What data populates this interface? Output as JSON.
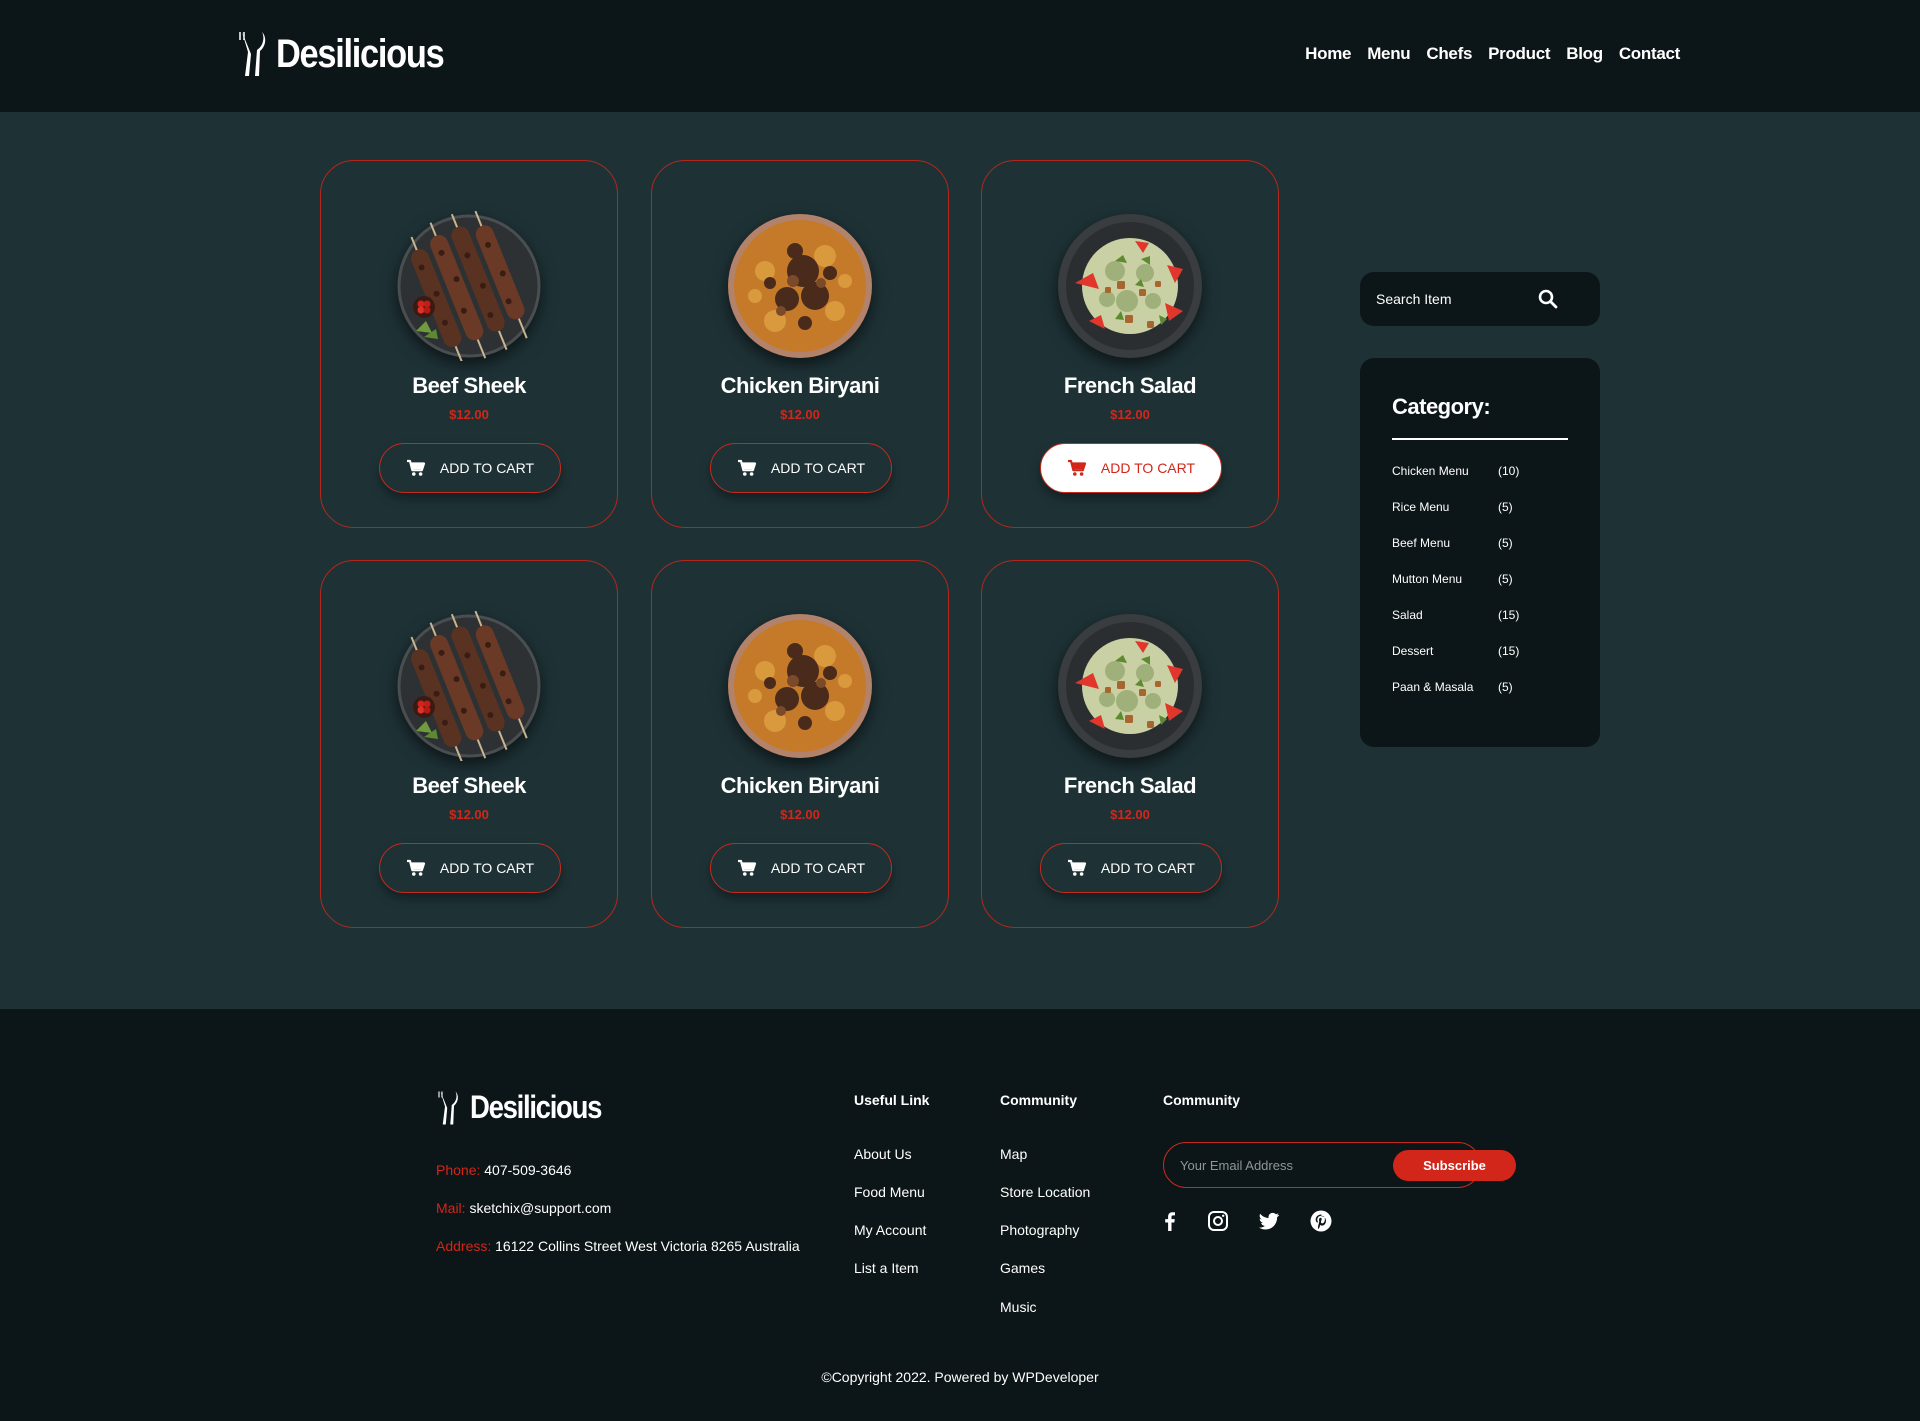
{
  "brand": {
    "name": "Desilicious"
  },
  "nav": [
    {
      "label": "Home"
    },
    {
      "label": "Menu"
    },
    {
      "label": "Chefs"
    },
    {
      "label": "Product"
    },
    {
      "label": "Blog"
    },
    {
      "label": "Contact"
    }
  ],
  "products": [
    {
      "name": "Beef Sheek",
      "price": "$12.00",
      "button": "ADD TO CART",
      "image": "beef-kebab"
    },
    {
      "name": "Chicken Biryani",
      "price": "$12.00",
      "button": "ADD TO CART",
      "image": "biryani"
    },
    {
      "name": "French Salad",
      "price": "$12.00",
      "button": "ADD TO CART",
      "image": "salad",
      "highlighted": true
    },
    {
      "name": "Beef Sheek",
      "price": "$12.00",
      "button": "ADD TO CART",
      "image": "beef-kebab"
    },
    {
      "name": "Chicken Biryani",
      "price": "$12.00",
      "button": "ADD TO CART",
      "image": "biryani"
    },
    {
      "name": "French Salad",
      "price": "$12.00",
      "button": "ADD TO CART",
      "image": "salad"
    }
  ],
  "search": {
    "placeholder": "Search Item",
    "icon": "search-icon"
  },
  "category": {
    "title": "Category:",
    "items": [
      {
        "name": "Chicken Menu",
        "count": "(10)"
      },
      {
        "name": "Rice Menu",
        "count": "(5)"
      },
      {
        "name": "Beef Menu",
        "count": "(5)"
      },
      {
        "name": "Mutton Menu",
        "count": "(5)"
      },
      {
        "name": "Salad",
        "count": "(15)"
      },
      {
        "name": "Dessert",
        "count": "(15)"
      },
      {
        "name": "Paan & Masala",
        "count": "(5)"
      }
    ]
  },
  "footer": {
    "phone_label": "Phone:",
    "phone": "407-509-3646",
    "mail_label": "Mail:",
    "mail": "sketchix@support.com",
    "address_label": "Address:",
    "address": "16122 Collins Street West Victoria 8265 Australia",
    "col1_title": "Useful Link",
    "col1_links": [
      "About Us",
      "Food Menu",
      "My Account",
      "List a Item"
    ],
    "col2_title": "Community",
    "col2_links": [
      "Map",
      "Store Location",
      "Photography",
      "Games",
      "Music"
    ],
    "col3_title": "Community",
    "email_placeholder": "Your Email Address",
    "subscribe_label": "Subscribe",
    "social": [
      "facebook-icon",
      "instagram-icon",
      "twitter-icon",
      "pinterest-icon"
    ],
    "copyright": "©Copyright 2022. Powered by WPDeveloper"
  },
  "colors": {
    "accent": "#d2261a",
    "header_bg": "#0c1517",
    "main_bg": "#1e3236",
    "card_border": "#b3281a"
  }
}
